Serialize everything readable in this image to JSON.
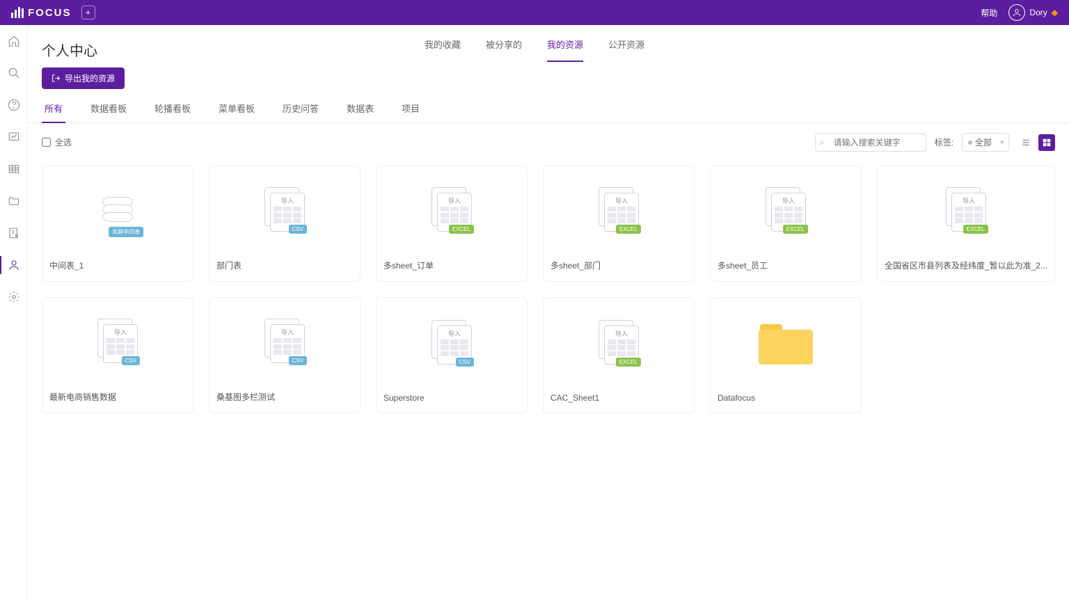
{
  "brand": "FOCUS",
  "help": "帮助",
  "user": "Dory",
  "page_title": "个人中心",
  "top_tabs": [
    "我的收藏",
    "被分享的",
    "我的资源",
    "公开资源"
  ],
  "top_active": 2,
  "export_btn": "导出我的资源",
  "sub_tabs": [
    "所有",
    "数据看板",
    "轮播看板",
    "菜单看板",
    "历史问答",
    "数据表",
    "项目"
  ],
  "sub_active": 0,
  "select_all": "全选",
  "search_placeholder": "请输入搜索关键字",
  "tag_label": "标签:",
  "tag_value": "全部",
  "import_label": "导入",
  "db_badge": "关联中间表",
  "cards": [
    {
      "name": "中间表_1",
      "type": "db",
      "badge": ""
    },
    {
      "name": "部门表",
      "type": "sheet",
      "badge": "CSV",
      "badgeClass": "b-csv"
    },
    {
      "name": "多sheet_订单",
      "type": "sheet",
      "badge": "EXCEL",
      "badgeClass": "b-excel"
    },
    {
      "name": "多sheet_部门",
      "type": "sheet",
      "badge": "EXCEL",
      "badgeClass": "b-excel"
    },
    {
      "name": "多sheet_员工",
      "type": "sheet",
      "badge": "EXCEL",
      "badgeClass": "b-excel"
    },
    {
      "name": "全国省区市县列表及经纬度_暂以此为准_2...",
      "type": "sheet",
      "badge": "EXCEL",
      "badgeClass": "b-excel"
    },
    {
      "name": "最新电商销售数据",
      "type": "sheet",
      "badge": "CSV",
      "badgeClass": "b-csv"
    },
    {
      "name": "桑基图多栏测试",
      "type": "sheet",
      "badge": "CSV",
      "badgeClass": "b-csv"
    },
    {
      "name": "Superstore",
      "type": "sheet",
      "badge": "CSV",
      "badgeClass": "b-csv"
    },
    {
      "name": "CAC_Sheet1",
      "type": "sheet",
      "badge": "EXCEL",
      "badgeClass": "b-excel"
    },
    {
      "name": "Datafocus",
      "type": "folder",
      "badge": ""
    }
  ]
}
